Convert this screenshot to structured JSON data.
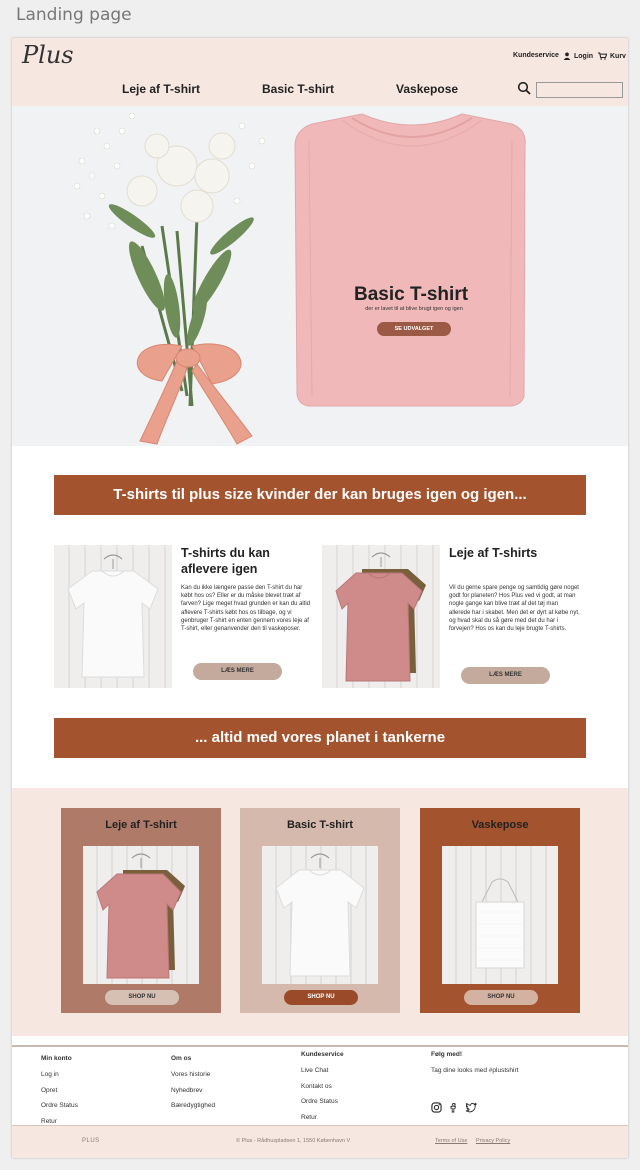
{
  "frame_label": "Landing page",
  "header": {
    "logo": "Plus",
    "customer_service": "Kundeservice",
    "login": "Login",
    "cart": "Kurv",
    "nav": [
      "Leje af T-shirt",
      "Basic T-shirt",
      "Vaskepose"
    ],
    "search_placeholder": ""
  },
  "hero": {
    "title": "Basic T-shirt",
    "subtitle": "der er lavet til at blive brugt igen og igen",
    "button": "SE UDVALGET"
  },
  "banner_top": "T-shirts til plus size kvinder der kan bruges igen og igen...",
  "banner_bottom": "... altid med vores planet i tankerne",
  "features": [
    {
      "title": "T-shirts du kan aflevere igen",
      "body": "Kan du ikke længere passe den T-shirt du har købt hos os? Eller er du måske blevet træt af farven? Lige meget hvad grunden er kan du altid aflevere T-shirts købt hos os tilbage, og vi genbruger T-shirt en enten gennem vores leje af T-shirt, eller genanvender den til vaskeposer.",
      "button": "LÆS MERE"
    },
    {
      "title": "Leje af T-shirts",
      "body": "Vil du gerne spare penge og samtidig gøre noget godt for planeten? Hos Plus ved vi godt, at man nogle gange kan blive træt af det tøj man allerede har i skabet. Men det er dyrt at købe nyt, og hvad skal du så gøre med det du har i forvejen? Hos os kan du leje brugte T-shirts.",
      "button": "LÆS MERE"
    }
  ],
  "products": [
    {
      "title": "Leje af T-shirt",
      "button": "SHOP NU",
      "bg": "#b07a68",
      "btn_bg": "#d6c0b4",
      "btn_color": "#333333"
    },
    {
      "title": "Basic T-shirt",
      "button": "SHOP NU",
      "bg": "#d4b9ac",
      "btn_bg": "#9a4a28",
      "btn_color": "#ffffff"
    },
    {
      "title": "Vaskepose",
      "button": "SHOP NU",
      "bg": "#a3532d",
      "btn_bg": "#d4b2a2",
      "btn_color": "#333333"
    }
  ],
  "footer": {
    "col1": [
      "Min konto",
      "Log in",
      "Opret",
      "Ordre Status",
      "Retur"
    ],
    "col2": [
      "Om os",
      "Vores historie",
      "Nyhedbrev",
      "Bæredygtighed"
    ],
    "col3": [
      "Kundeservice",
      "Live Chat",
      "Kontakt os",
      "Ordre Status",
      "Retur"
    ],
    "col4_heading": "Følg med!",
    "col4_text": "Tag dine looks med #plustshirt",
    "social_icons": [
      "instagram-icon",
      "facebook-icon",
      "twitter-icon"
    ],
    "brand": "PLUS",
    "address": "© Plus - Rådhuspladsen 1, 1550 København V",
    "terms": "Terms of Use",
    "privacy": "Privacy Policy"
  },
  "colors": {
    "accent_brown": "#a3532d",
    "header_bg": "#f6e7e1",
    "tshirt_pink": "#f0b8b9"
  }
}
